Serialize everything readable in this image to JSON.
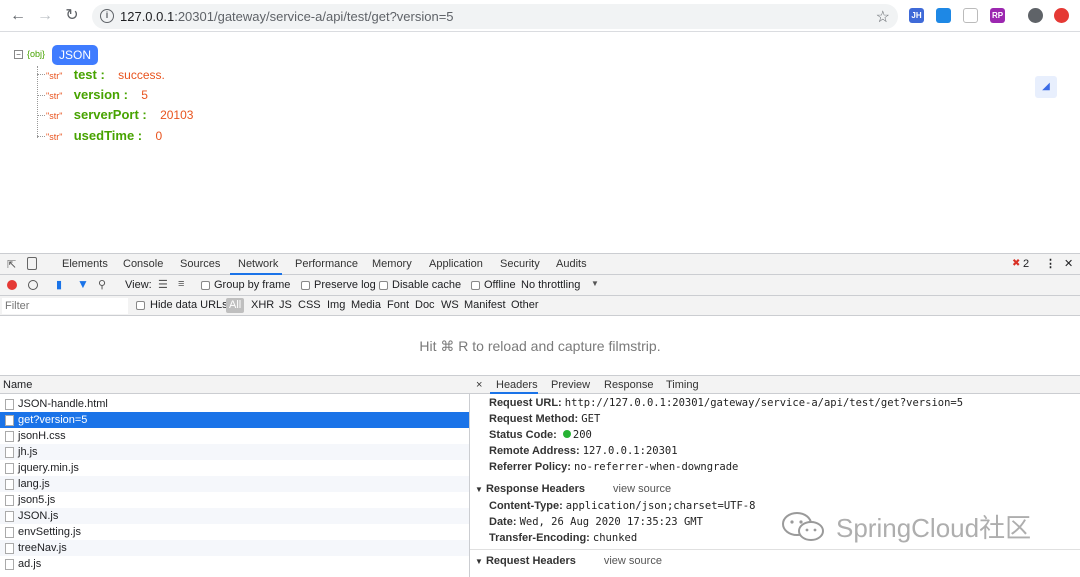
{
  "browser": {
    "url_host": "127.0.0.1",
    "url_rest": ":20301/gateway/service-a/api/test/get?version=5",
    "extensions": [
      "JH",
      "",
      "",
      "RP",
      ""
    ]
  },
  "json_view": {
    "root_type": "{obj}",
    "root_label": "JSON",
    "entries": [
      {
        "type": "\"str\"",
        "key": "test :",
        "value": "success."
      },
      {
        "type": "\"str\"",
        "key": "version :",
        "value": "5"
      },
      {
        "type": "\"str\"",
        "key": "serverPort :",
        "value": "20103"
      },
      {
        "type": "\"str\"",
        "key": "usedTime :",
        "value": "0"
      }
    ]
  },
  "devtools": {
    "tabs": [
      "Elements",
      "Console",
      "Sources",
      "Network",
      "Performance",
      "Memory",
      "Application",
      "Security",
      "Audits"
    ],
    "active_tab": "Network",
    "error_count": "2",
    "toolbar": {
      "view_label": "View:",
      "group_by_frame": "Group by frame",
      "preserve_log": "Preserve log",
      "disable_cache": "Disable cache",
      "offline": "Offline",
      "throttling": "No throttling"
    },
    "filter": {
      "placeholder": "Filter",
      "hide_data_urls": "Hide data URLs",
      "types": [
        "All",
        "XHR",
        "JS",
        "CSS",
        "Img",
        "Media",
        "Font",
        "Doc",
        "WS",
        "Manifest",
        "Other"
      ]
    },
    "filmstrip_message": "Hit ⌘ R to reload and capture filmstrip.",
    "requests": {
      "header": "Name",
      "items": [
        "JSON-handle.html",
        "get?version=5",
        "jsonH.css",
        "jh.js",
        "jquery.min.js",
        "lang.js",
        "json5.js",
        "JSON.js",
        "envSetting.js",
        "treeNav.js",
        "ad.js"
      ],
      "selected_index": 1
    },
    "detail": {
      "close": "×",
      "tabs": [
        "Headers",
        "Preview",
        "Response",
        "Timing"
      ],
      "general": [
        {
          "k": "Request URL:",
          "v": "http://127.0.0.1:20301/gateway/service-a/api/test/get?version=5"
        },
        {
          "k": "Request Method:",
          "v": "GET"
        },
        {
          "k": "Status Code:",
          "v": "200"
        },
        {
          "k": "Remote Address:",
          "v": "127.0.0.1:20301"
        },
        {
          "k": "Referrer Policy:",
          "v": "no-referrer-when-downgrade"
        }
      ],
      "response_headers_title": "Response Headers",
      "view_source": "view source",
      "response_headers": [
        {
          "k": "Content-Type:",
          "v": "application/json;charset=UTF-8"
        },
        {
          "k": "Date:",
          "v": "Wed, 26 Aug 2020 17:35:23 GMT"
        },
        {
          "k": "Transfer-Encoding:",
          "v": "chunked"
        }
      ],
      "request_headers_title": "Request Headers"
    }
  },
  "watermark": "SpringCloud社区",
  "colors": {
    "accent": "#1a73e8",
    "json_key": "#47a300",
    "json_value": "#e8531e",
    "status_ok": "#27b334"
  }
}
